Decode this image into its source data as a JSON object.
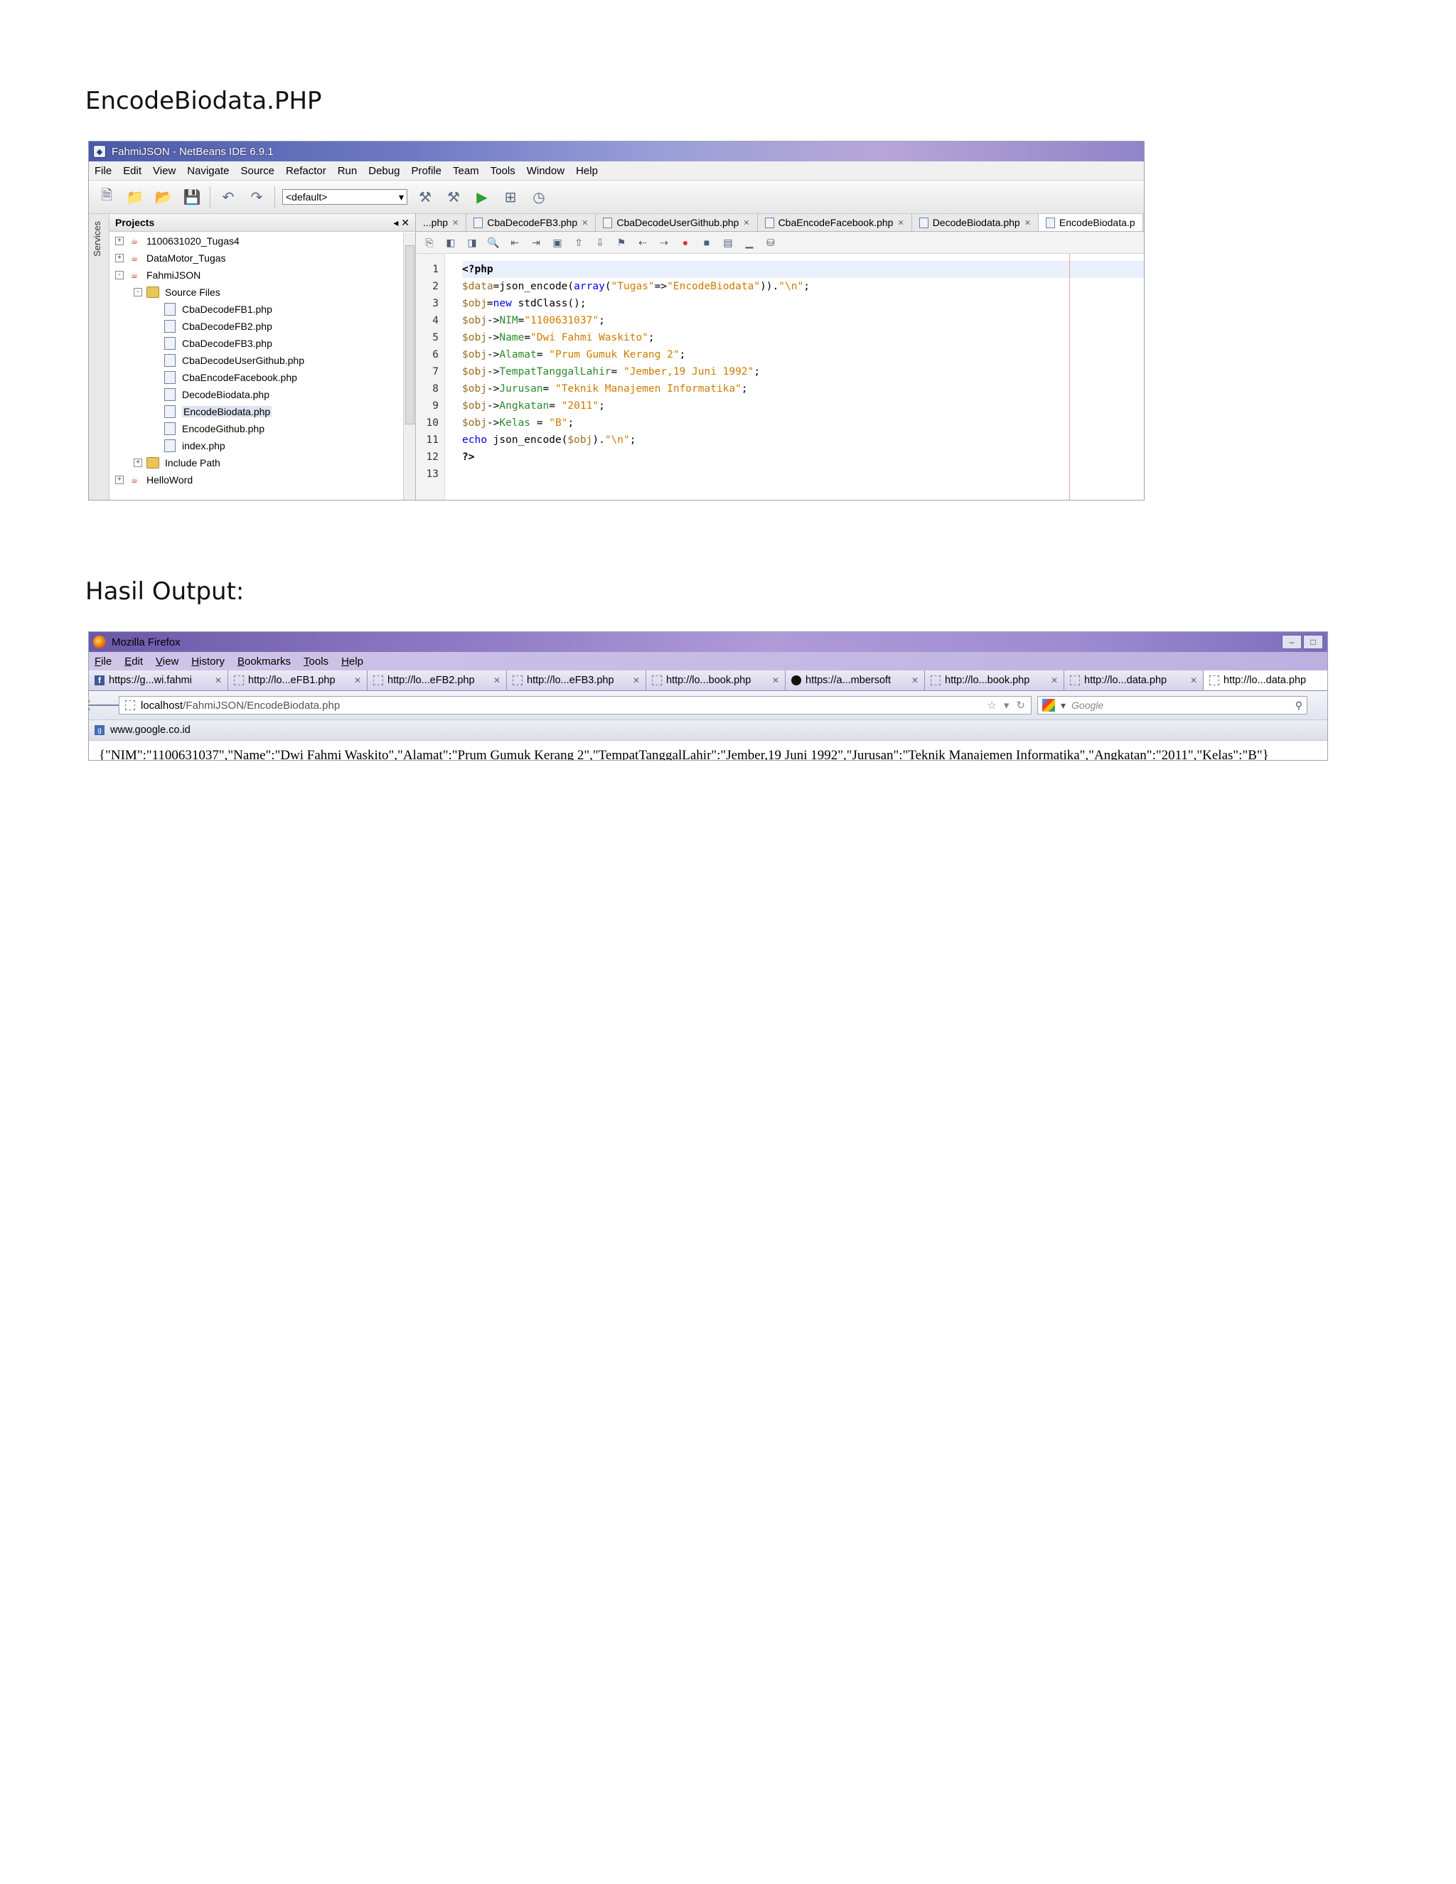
{
  "doc": {
    "heading1": "EncodeBiodata.PHP",
    "heading2": "Hasil Output:"
  },
  "netbeans": {
    "title": "FahmiJSON - NetBeans IDE 6.9.1",
    "menu": [
      "File",
      "Edit",
      "View",
      "Navigate",
      "Source",
      "Refactor",
      "Run",
      "Debug",
      "Profile",
      "Team",
      "Tools",
      "Window",
      "Help"
    ],
    "config": "<default>",
    "services_label": "Services",
    "projects_title": "Projects",
    "tree": [
      {
        "label": "1100631020_Tugas4",
        "level": 0,
        "toggle": "+",
        "icon": "project"
      },
      {
        "label": "DataMotor_Tugas",
        "level": 0,
        "toggle": "+",
        "icon": "project"
      },
      {
        "label": "FahmiJSON",
        "level": 0,
        "toggle": "-",
        "icon": "project"
      },
      {
        "label": "Source Files",
        "level": 1,
        "toggle": "-",
        "icon": "folder"
      },
      {
        "label": "CbaDecodeFB1.php",
        "level": 2,
        "icon": "file"
      },
      {
        "label": "CbaDecodeFB2.php",
        "level": 2,
        "icon": "file"
      },
      {
        "label": "CbaDecodeFB3.php",
        "level": 2,
        "icon": "file"
      },
      {
        "label": "CbaDecodeUserGithub.php",
        "level": 2,
        "icon": "file"
      },
      {
        "label": "CbaEncodeFacebook.php",
        "level": 2,
        "icon": "file"
      },
      {
        "label": "DecodeBiodata.php",
        "level": 2,
        "icon": "file"
      },
      {
        "label": "EncodeBiodata.php",
        "level": 2,
        "icon": "file",
        "selected": true
      },
      {
        "label": "EncodeGithub.php",
        "level": 2,
        "icon": "file"
      },
      {
        "label": "index.php",
        "level": 2,
        "icon": "file"
      },
      {
        "label": "Include Path",
        "level": 1,
        "toggle": "+",
        "icon": "folder"
      },
      {
        "label": "HelloWord",
        "level": 0,
        "toggle": "+",
        "icon": "project"
      }
    ],
    "tabs": [
      {
        "label": "...php",
        "active": false
      },
      {
        "label": "CbaDecodeFB3.php",
        "active": false
      },
      {
        "label": "CbaDecodeUserGithub.php",
        "active": false
      },
      {
        "label": "CbaEncodeFacebook.php",
        "active": false
      },
      {
        "label": "DecodeBiodata.php",
        "active": false
      },
      {
        "label": "EncodeBiodata.p",
        "active": true
      }
    ],
    "code": [
      [
        [
          "php",
          "<?php"
        ]
      ],
      [
        [
          "var",
          "$data"
        ],
        [
          "plain",
          "=json_encode("
        ],
        [
          "kw",
          "array"
        ],
        [
          "plain",
          "("
        ],
        [
          "str",
          "\"Tugas\""
        ],
        [
          "plain",
          "=>"
        ],
        [
          "str",
          "\"EncodeBiodata\""
        ],
        [
          "plain",
          "))."
        ],
        [
          "str",
          "\"\\n\""
        ],
        [
          "plain",
          ";"
        ]
      ],
      [
        [
          "var",
          "$obj"
        ],
        [
          "plain",
          "="
        ],
        [
          "kw",
          "new"
        ],
        [
          "plain",
          " stdClass();"
        ]
      ],
      [
        [
          "var",
          "$obj"
        ],
        [
          "plain",
          "->"
        ],
        [
          "prop",
          "NIM"
        ],
        [
          "plain",
          "="
        ],
        [
          "str",
          "\"1100631037\""
        ],
        [
          "plain",
          ";"
        ]
      ],
      [
        [
          "var",
          "$obj"
        ],
        [
          "plain",
          "->"
        ],
        [
          "prop",
          "Name"
        ],
        [
          "plain",
          "="
        ],
        [
          "str",
          "\"Dwi Fahmi Waskito\""
        ],
        [
          "plain",
          ";"
        ]
      ],
      [
        [
          "var",
          "$obj"
        ],
        [
          "plain",
          "->"
        ],
        [
          "prop",
          "Alamat"
        ],
        [
          "plain",
          "= "
        ],
        [
          "str",
          "\"Prum Gumuk Kerang 2\""
        ],
        [
          "plain",
          ";"
        ]
      ],
      [
        [
          "var",
          "$obj"
        ],
        [
          "plain",
          "->"
        ],
        [
          "prop",
          "TempatTanggalLahir"
        ],
        [
          "plain",
          "= "
        ],
        [
          "str",
          "\"Jember,19 Juni 1992\""
        ],
        [
          "plain",
          ";"
        ]
      ],
      [
        [
          "var",
          "$obj"
        ],
        [
          "plain",
          "->"
        ],
        [
          "prop",
          "Jurusan"
        ],
        [
          "plain",
          "= "
        ],
        [
          "str",
          "\"Teknik Manajemen Informatika\""
        ],
        [
          "plain",
          ";"
        ]
      ],
      [
        [
          "var",
          "$obj"
        ],
        [
          "plain",
          "->"
        ],
        [
          "prop",
          "Angkatan"
        ],
        [
          "plain",
          "= "
        ],
        [
          "str",
          "\"2011\""
        ],
        [
          "plain",
          ";"
        ]
      ],
      [
        [
          "var",
          "$obj"
        ],
        [
          "plain",
          "->"
        ],
        [
          "prop",
          "Kelas"
        ],
        [
          "plain",
          " = "
        ],
        [
          "str",
          "\"B\""
        ],
        [
          "plain",
          ";"
        ]
      ],
      [
        [
          "kw",
          "echo"
        ],
        [
          "plain",
          " json_encode("
        ],
        [
          "var",
          "$obj"
        ],
        [
          "plain",
          ")."
        ],
        [
          "str",
          "\"\\n\""
        ],
        [
          "plain",
          ";"
        ]
      ],
      [
        [
          "php",
          "?>"
        ]
      ],
      []
    ]
  },
  "firefox": {
    "title": "Mozilla Firefox",
    "menu": [
      {
        "key": "F",
        "rest": "ile"
      },
      {
        "key": "E",
        "rest": "dit"
      },
      {
        "key": "V",
        "rest": "iew"
      },
      {
        "key": "H",
        "rest": "istory"
      },
      {
        "key": "B",
        "rest": "ookmarks"
      },
      {
        "key": "T",
        "rest": "ools"
      },
      {
        "key": "H",
        "rest": "elp"
      }
    ],
    "tabs": [
      {
        "label": "https://g...wi.fahmi",
        "favicon": "facebook"
      },
      {
        "label": "http://lo...eFB1.php",
        "favicon": "blank"
      },
      {
        "label": "http://lo...eFB2.php",
        "favicon": "blank"
      },
      {
        "label": "http://lo...eFB3.php",
        "favicon": "blank"
      },
      {
        "label": "http://lo...book.php",
        "favicon": "blank"
      },
      {
        "label": "https://a...mbersoft",
        "favicon": "github"
      },
      {
        "label": "http://lo...book.php",
        "favicon": "blank"
      },
      {
        "label": "http://lo...data.php",
        "favicon": "blank"
      },
      {
        "label": "http://lo...data.php",
        "favicon": "blank",
        "active": true
      }
    ],
    "url_host": "localhost",
    "url_path": "/FahmiJSON/EncodeBiodata.php",
    "search_placeholder": "Google",
    "bookmark": "www.google.co.id",
    "output": "{\"NIM\":\"1100631037\",\"Name\":\"Dwi Fahmi Waskito\",\"Alamat\":\"Prum Gumuk Kerang 2\",\"TempatTanggalLahir\":\"Jember,19 Juni 1992\",\"Jurusan\":\"Teknik Manajemen Informatika\",\"Angkatan\":\"2011\",\"Kelas\":\"B\"}"
  }
}
